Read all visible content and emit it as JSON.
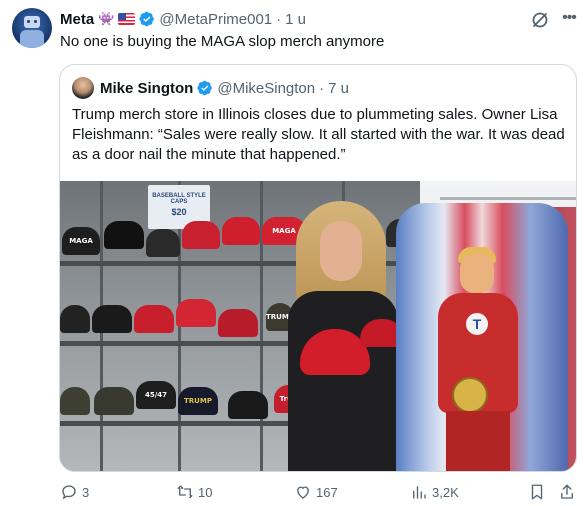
{
  "post": {
    "author": {
      "name": "Meta",
      "emoji": "👾",
      "handle": "@MetaPrime001",
      "time": "1 u",
      "separator": "·"
    },
    "text": "No one is buying the MAGA slop merch anymore",
    "quoted": {
      "author": {
        "name": "Mike Sington",
        "handle": "@MikeSington",
        "time": "7 u",
        "separator": "·"
      },
      "text": "Trump merch store in Illinois closes due to plummeting sales. Owner Lisa Fleishmann: “Sales were really slow. It all started with the war. It was dead as a door nail the minute that happened.”",
      "image": {
        "sign_title": "BASEBALL STYLE CAPS",
        "sign_price": "$20",
        "cap_labels": [
          "MAGA",
          "MAGA",
          "TRUMP",
          "45/47",
          "TRUMP",
          "Trump"
        ]
      }
    },
    "actions": {
      "replies": "3",
      "reposts": "10",
      "likes": "167",
      "views": "3,2K"
    }
  },
  "colors": {
    "verified": "#1d9bf0",
    "text_secondary": "#536471",
    "border": "#cfd9de"
  }
}
